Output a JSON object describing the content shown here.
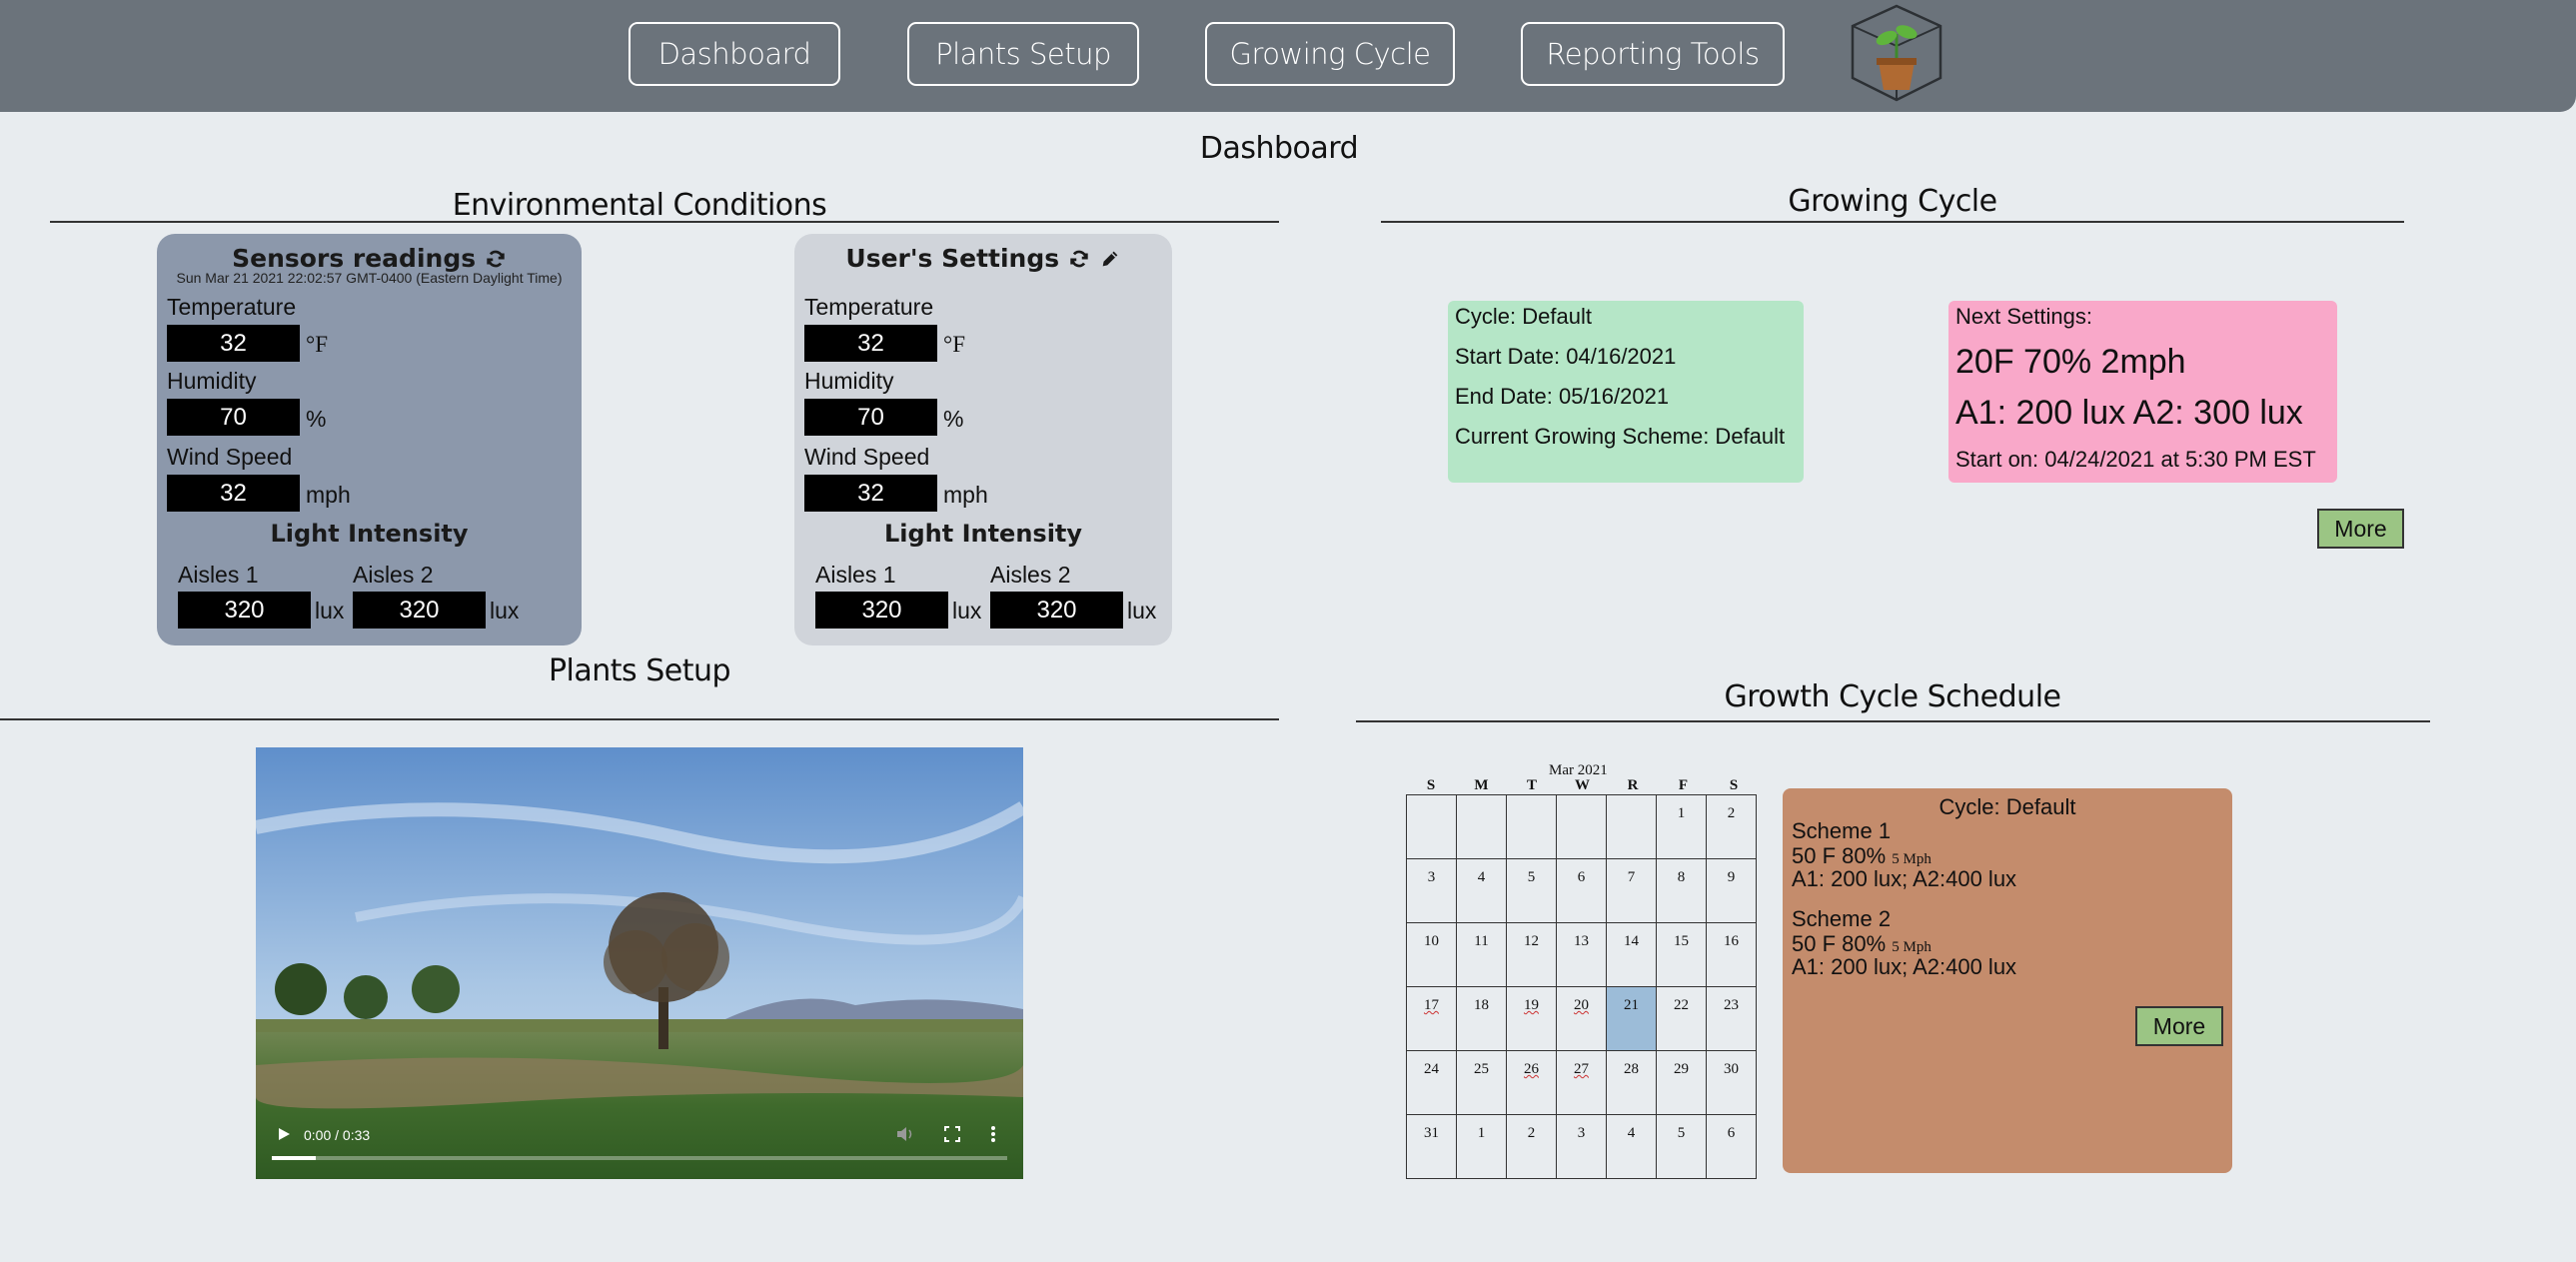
{
  "nav": {
    "items": [
      "Dashboard",
      "Plants Setup",
      "Growing Cycle",
      "Reporting Tools"
    ]
  },
  "page_title": "Dashboard",
  "env": {
    "title": "Environmental Conditions",
    "sensors": {
      "title": "Sensors readings",
      "timestamp": "Sun Mar 21 2021 22:02:57 GMT-0400 (Eastern Daylight Time)",
      "temperature_label": "Temperature",
      "temperature": "32",
      "temperature_unit": "°F",
      "humidity_label": "Humidity",
      "humidity": "70",
      "humidity_unit": "%",
      "wind_label": "Wind Speed",
      "wind": "32",
      "wind_unit": "mph",
      "light_label": "Light Intensity",
      "aisle1_label": "Aisles 1",
      "aisle1": "320",
      "aisle2_label": "Aisles 2",
      "aisle2": "320",
      "lux_unit": "lux"
    },
    "settings": {
      "title": "User's Settings",
      "temperature_label": "Temperature",
      "temperature": "32",
      "temperature_unit": "°F",
      "humidity_label": "Humidity",
      "humidity": "70",
      "humidity_unit": "%",
      "wind_label": "Wind Speed",
      "wind": "32",
      "wind_unit": "mph",
      "light_label": "Light Intensity",
      "aisle1_label": "Aisles 1",
      "aisle1": "320",
      "aisle2_label": "Aisles 2",
      "aisle2": "320",
      "lux_unit": "lux"
    }
  },
  "growing": {
    "title": "Growing Cycle",
    "cycle": "Cycle: Default",
    "start": "Start Date: 04/16/2021",
    "end": "End Date: 05/16/2021",
    "scheme": "Current Growing Scheme: Default",
    "next_label": "Next Settings:",
    "next_line1": "20F 70% 2mph",
    "next_line2": "A1: 200 lux A2: 300 lux",
    "next_start": "Start on: 04/24/2021 at 5:30 PM EST",
    "more": "More"
  },
  "plants": {
    "title": "Plants Setup",
    "video_time": "0:00 / 0:33",
    "video_progress": 0.06
  },
  "schedule": {
    "title": "Growth Cycle Schedule",
    "month": "Mar 2021",
    "weekdays": [
      "S",
      "M",
      "T",
      "W",
      "R",
      "F",
      "S"
    ],
    "weeks": [
      [
        "",
        "",
        "",
        "",
        "",
        "1",
        "2"
      ],
      [
        "3",
        "4",
        "5",
        "6",
        "7",
        "8",
        "9"
      ],
      [
        "10",
        "11",
        "12",
        "13",
        "14",
        "15",
        "16"
      ],
      [
        "17",
        "18",
        "19",
        "20",
        "21",
        "22",
        "23"
      ],
      [
        "24",
        "25",
        "26",
        "27",
        "28",
        "29",
        "30"
      ],
      [
        "31",
        "1",
        "2",
        "3",
        "4",
        "5",
        "6"
      ]
    ],
    "today": "21",
    "marked_days": [
      "17",
      "19",
      "20",
      "26",
      "27"
    ],
    "cycle": "Cycle: Default",
    "scheme1_title": "Scheme 1",
    "scheme1_main": "50 F 80%",
    "scheme1_wind": "5 Mph",
    "scheme1_lux": "A1: 200 lux; A2:400 lux",
    "scheme2_title": "Scheme 2",
    "scheme2_main": "50 F 80%",
    "scheme2_wind": "5 Mph",
    "scheme2_lux": "A1: 200 lux; A2:400 lux",
    "more": "More"
  },
  "colors": {
    "topbar": "#6b737b",
    "sensors_card": "#8c98ab",
    "settings_card": "#d0d4da",
    "cycle_panel": "#b5e6c7",
    "next_panel": "#f9a8c9",
    "scheme_panel": "#c48c6c",
    "more_button": "#9bc584",
    "today": "#9cbcd8"
  },
  "icons": [
    "plant-logo-icon",
    "refresh-icon",
    "pencil-icon",
    "play-icon",
    "volume-icon",
    "fullscreen-icon",
    "more-vert-icon"
  ]
}
